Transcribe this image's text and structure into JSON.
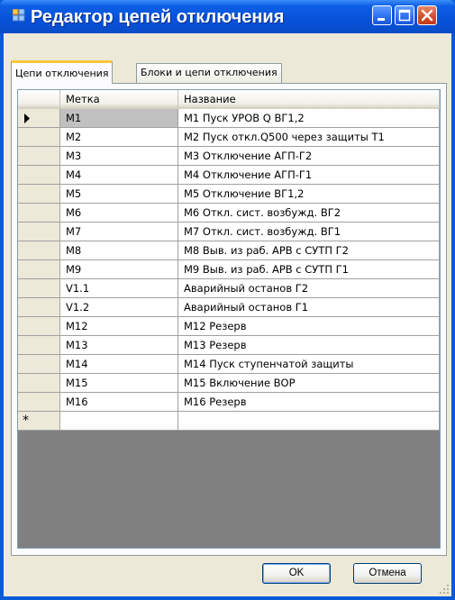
{
  "window": {
    "title": "Редактор цепей отключения"
  },
  "tabs": [
    {
      "label": "Цепи отключения",
      "active": true
    },
    {
      "label": "Блоки и цепи отключения",
      "active": false
    }
  ],
  "grid": {
    "columns": [
      "Метка",
      "Название"
    ],
    "selected_row": 0,
    "rows": [
      {
        "label": "M1",
        "name": "M1 Пуск УРОВ Q ВГ1,2"
      },
      {
        "label": "M2",
        "name": "M2 Пуск откл.Q500 через защиты Т1"
      },
      {
        "label": "M3",
        "name": "M3 Отключение АГП-Г2"
      },
      {
        "label": "M4",
        "name": "M4 Отключение АГП-Г1"
      },
      {
        "label": "M5",
        "name": "M5 Отключение ВГ1,2"
      },
      {
        "label": "M6",
        "name": "M6 Откл. сист. возбужд. ВГ2"
      },
      {
        "label": "M7",
        "name": "M7 Откл. сист. возбужд. ВГ1"
      },
      {
        "label": "M8",
        "name": "M8 Выв. из раб. АРВ с СУТП Г2"
      },
      {
        "label": "M9",
        "name": "M9 Выв. из раб. АРВ с СУТП Г1"
      },
      {
        "label": "V1.1",
        "name": "Аварийный останов Г2"
      },
      {
        "label": "V1.2",
        "name": "Аварийный останов Г1"
      },
      {
        "label": "M12",
        "name": "M12 Резерв"
      },
      {
        "label": "M13",
        "name": "M13 Резерв"
      },
      {
        "label": "M14",
        "name": "M14 Пуск ступенчатой защиты"
      },
      {
        "label": "M15",
        "name": "M15 Включение ВОР"
      },
      {
        "label": "M16",
        "name": "M16 Резерв"
      }
    ],
    "new_row_marker": "*"
  },
  "buttons": {
    "ok": "OK",
    "cancel": "Отмена"
  },
  "icons": {
    "app": "app-window-icon",
    "minimize": "minimize-icon",
    "maximize": "maximize-icon",
    "close": "close-icon",
    "current_row": "row-pointer-icon",
    "resize": "resize-grip-icon"
  },
  "colors": {
    "titlebar": "#0a5ad8",
    "client": "#ece9d8",
    "tab_active_accent": "#ffc73c",
    "close_button": "#d5502c"
  }
}
